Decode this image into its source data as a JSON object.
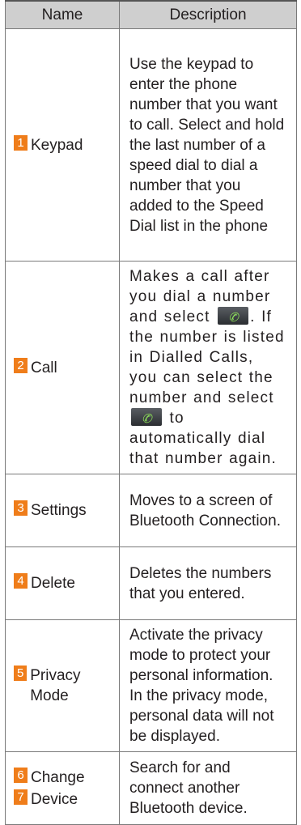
{
  "header": {
    "name": "Name",
    "description": "Description"
  },
  "rows": [
    {
      "num": "1",
      "name": "Keypad",
      "desc": "Use the keypad to enter the phone number that you want to call. Select and hold the last number of a speed dial to dial a number that you added to the Speed Dial list in the phone"
    },
    {
      "num": "2",
      "name": "Call",
      "desc_a": "Makes a call after you dial a number and select",
      "desc_b": ". If the number is listed in Dialled Calls, you can select the number and select",
      "desc_c": "to automatically dial that number again.",
      "icon": "phone-call-icon"
    },
    {
      "num": "3",
      "name": "Settings",
      "desc": "Moves to a screen of Bluetooth Connection."
    },
    {
      "num": "4",
      "name": "Delete",
      "desc": "Deletes the numbers that you entered."
    },
    {
      "num": "5",
      "name": "Privacy Mode",
      "desc": "Activate the privacy mode to protect your personal information. In the privacy mode, personal data will not be displayed."
    },
    {
      "num": "6",
      "num2": "7",
      "name": "Change",
      "name2": "Device",
      "desc": "Search for and connect another Bluetooth device."
    }
  ],
  "colors": {
    "badge": "#ef7d1a",
    "header_bg": "#cfcfcf",
    "call_glyph": "#8fe35a"
  }
}
